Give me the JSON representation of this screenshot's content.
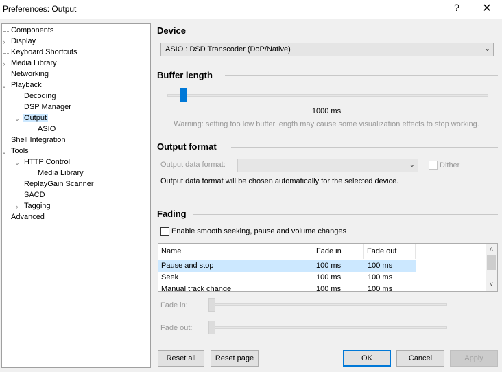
{
  "window": {
    "title": "Preferences: Output",
    "help_glyph": "?",
    "close_glyph": "✕"
  },
  "tree": [
    {
      "label": "Components",
      "level": 0,
      "expander": "",
      "selected": false
    },
    {
      "label": "Display",
      "level": 0,
      "expander": "›",
      "selected": false
    },
    {
      "label": "Keyboard Shortcuts",
      "level": 0,
      "expander": "",
      "selected": false
    },
    {
      "label": "Media Library",
      "level": 0,
      "expander": "›",
      "selected": false
    },
    {
      "label": "Networking",
      "level": 0,
      "expander": "",
      "selected": false
    },
    {
      "label": "Playback",
      "level": 0,
      "expander": "⌄",
      "selected": false
    },
    {
      "label": "Decoding",
      "level": 1,
      "expander": "",
      "selected": false
    },
    {
      "label": "DSP Manager",
      "level": 1,
      "expander": "",
      "selected": false
    },
    {
      "label": "Output",
      "level": 1,
      "expander": "⌄",
      "selected": true
    },
    {
      "label": "ASIO",
      "level": 2,
      "expander": "",
      "selected": false
    },
    {
      "label": "Shell Integration",
      "level": 0,
      "expander": "",
      "selected": false
    },
    {
      "label": "Tools",
      "level": 0,
      "expander": "⌄",
      "selected": false
    },
    {
      "label": "HTTP Control",
      "level": 1,
      "expander": "⌄",
      "selected": false
    },
    {
      "label": "Media Library",
      "level": 2,
      "expander": "",
      "selected": false
    },
    {
      "label": "ReplayGain Scanner",
      "level": 1,
      "expander": "",
      "selected": false
    },
    {
      "label": "SACD",
      "level": 1,
      "expander": "",
      "selected": false
    },
    {
      "label": "Tagging",
      "level": 1,
      "expander": "›",
      "selected": false
    },
    {
      "label": "Advanced",
      "level": 0,
      "expander": "",
      "selected": false
    }
  ],
  "device": {
    "title": "Device",
    "selected": "ASIO : DSD Transcoder (DoP/Native)",
    "arrow": "⌄"
  },
  "buffer": {
    "title": "Buffer length",
    "value_label": "1000 ms",
    "slider_fraction": 0.04,
    "warning": "Warning: setting too low buffer length may cause some visualization effects to stop working."
  },
  "output_format": {
    "title": "Output format",
    "data_format_label": "Output data format:",
    "data_format_value": "",
    "arrow": "⌄",
    "dither_label": "Dither",
    "info": "Output data format will be chosen automatically for the selected device."
  },
  "fading": {
    "title": "Fading",
    "enable_label": "Enable smooth seeking, pause and volume changes",
    "columns": [
      "Name",
      "Fade in",
      "Fade out"
    ],
    "rows": [
      {
        "name": "Pause and stop",
        "fade_in": "100 ms",
        "fade_out": "100 ms"
      },
      {
        "name": "Seek",
        "fade_in": "100 ms",
        "fade_out": "100 ms"
      },
      {
        "name": "Manual track change",
        "fade_in": "100 ms",
        "fade_out": "100 ms"
      }
    ],
    "fade_in_label": "Fade in:",
    "fade_out_label": "Fade out:",
    "scroll_up": "˄",
    "scroll_down": "˅"
  },
  "buttons": {
    "reset_all": "Reset all",
    "reset_page": "Reset page",
    "ok": "OK",
    "cancel": "Cancel",
    "apply": "Apply"
  },
  "colors": {
    "accent": "#0078d7",
    "selection": "#cce8ff"
  }
}
